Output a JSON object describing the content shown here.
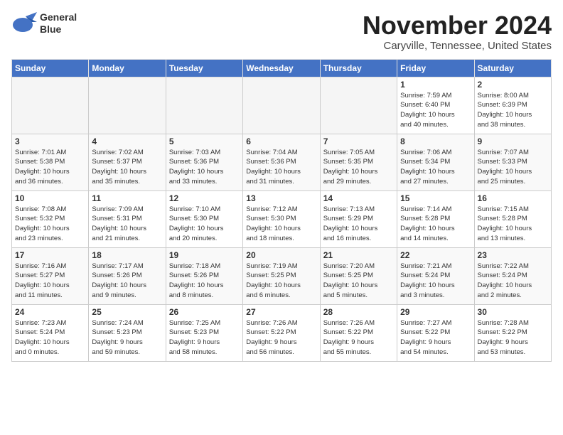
{
  "header": {
    "logo_line1": "General",
    "logo_line2": "Blue",
    "month": "November 2024",
    "location": "Caryville, Tennessee, United States"
  },
  "weekdays": [
    "Sunday",
    "Monday",
    "Tuesday",
    "Wednesday",
    "Thursday",
    "Friday",
    "Saturday"
  ],
  "weeks": [
    [
      {
        "day": "",
        "info": ""
      },
      {
        "day": "",
        "info": ""
      },
      {
        "day": "",
        "info": ""
      },
      {
        "day": "",
        "info": ""
      },
      {
        "day": "",
        "info": ""
      },
      {
        "day": "1",
        "info": "Sunrise: 7:59 AM\nSunset: 6:40 PM\nDaylight: 10 hours\nand 40 minutes."
      },
      {
        "day": "2",
        "info": "Sunrise: 8:00 AM\nSunset: 6:39 PM\nDaylight: 10 hours\nand 38 minutes."
      }
    ],
    [
      {
        "day": "3",
        "info": "Sunrise: 7:01 AM\nSunset: 5:38 PM\nDaylight: 10 hours\nand 36 minutes."
      },
      {
        "day": "4",
        "info": "Sunrise: 7:02 AM\nSunset: 5:37 PM\nDaylight: 10 hours\nand 35 minutes."
      },
      {
        "day": "5",
        "info": "Sunrise: 7:03 AM\nSunset: 5:36 PM\nDaylight: 10 hours\nand 33 minutes."
      },
      {
        "day": "6",
        "info": "Sunrise: 7:04 AM\nSunset: 5:36 PM\nDaylight: 10 hours\nand 31 minutes."
      },
      {
        "day": "7",
        "info": "Sunrise: 7:05 AM\nSunset: 5:35 PM\nDaylight: 10 hours\nand 29 minutes."
      },
      {
        "day": "8",
        "info": "Sunrise: 7:06 AM\nSunset: 5:34 PM\nDaylight: 10 hours\nand 27 minutes."
      },
      {
        "day": "9",
        "info": "Sunrise: 7:07 AM\nSunset: 5:33 PM\nDaylight: 10 hours\nand 25 minutes."
      }
    ],
    [
      {
        "day": "10",
        "info": "Sunrise: 7:08 AM\nSunset: 5:32 PM\nDaylight: 10 hours\nand 23 minutes."
      },
      {
        "day": "11",
        "info": "Sunrise: 7:09 AM\nSunset: 5:31 PM\nDaylight: 10 hours\nand 21 minutes."
      },
      {
        "day": "12",
        "info": "Sunrise: 7:10 AM\nSunset: 5:30 PM\nDaylight: 10 hours\nand 20 minutes."
      },
      {
        "day": "13",
        "info": "Sunrise: 7:12 AM\nSunset: 5:30 PM\nDaylight: 10 hours\nand 18 minutes."
      },
      {
        "day": "14",
        "info": "Sunrise: 7:13 AM\nSunset: 5:29 PM\nDaylight: 10 hours\nand 16 minutes."
      },
      {
        "day": "15",
        "info": "Sunrise: 7:14 AM\nSunset: 5:28 PM\nDaylight: 10 hours\nand 14 minutes."
      },
      {
        "day": "16",
        "info": "Sunrise: 7:15 AM\nSunset: 5:28 PM\nDaylight: 10 hours\nand 13 minutes."
      }
    ],
    [
      {
        "day": "17",
        "info": "Sunrise: 7:16 AM\nSunset: 5:27 PM\nDaylight: 10 hours\nand 11 minutes."
      },
      {
        "day": "18",
        "info": "Sunrise: 7:17 AM\nSunset: 5:26 PM\nDaylight: 10 hours\nand 9 minutes."
      },
      {
        "day": "19",
        "info": "Sunrise: 7:18 AM\nSunset: 5:26 PM\nDaylight: 10 hours\nand 8 minutes."
      },
      {
        "day": "20",
        "info": "Sunrise: 7:19 AM\nSunset: 5:25 PM\nDaylight: 10 hours\nand 6 minutes."
      },
      {
        "day": "21",
        "info": "Sunrise: 7:20 AM\nSunset: 5:25 PM\nDaylight: 10 hours\nand 5 minutes."
      },
      {
        "day": "22",
        "info": "Sunrise: 7:21 AM\nSunset: 5:24 PM\nDaylight: 10 hours\nand 3 minutes."
      },
      {
        "day": "23",
        "info": "Sunrise: 7:22 AM\nSunset: 5:24 PM\nDaylight: 10 hours\nand 2 minutes."
      }
    ],
    [
      {
        "day": "24",
        "info": "Sunrise: 7:23 AM\nSunset: 5:24 PM\nDaylight: 10 hours\nand 0 minutes."
      },
      {
        "day": "25",
        "info": "Sunrise: 7:24 AM\nSunset: 5:23 PM\nDaylight: 9 hours\nand 59 minutes."
      },
      {
        "day": "26",
        "info": "Sunrise: 7:25 AM\nSunset: 5:23 PM\nDaylight: 9 hours\nand 58 minutes."
      },
      {
        "day": "27",
        "info": "Sunrise: 7:26 AM\nSunset: 5:22 PM\nDaylight: 9 hours\nand 56 minutes."
      },
      {
        "day": "28",
        "info": "Sunrise: 7:26 AM\nSunset: 5:22 PM\nDaylight: 9 hours\nand 55 minutes."
      },
      {
        "day": "29",
        "info": "Sunrise: 7:27 AM\nSunset: 5:22 PM\nDaylight: 9 hours\nand 54 minutes."
      },
      {
        "day": "30",
        "info": "Sunrise: 7:28 AM\nSunset: 5:22 PM\nDaylight: 9 hours\nand 53 minutes."
      }
    ]
  ]
}
